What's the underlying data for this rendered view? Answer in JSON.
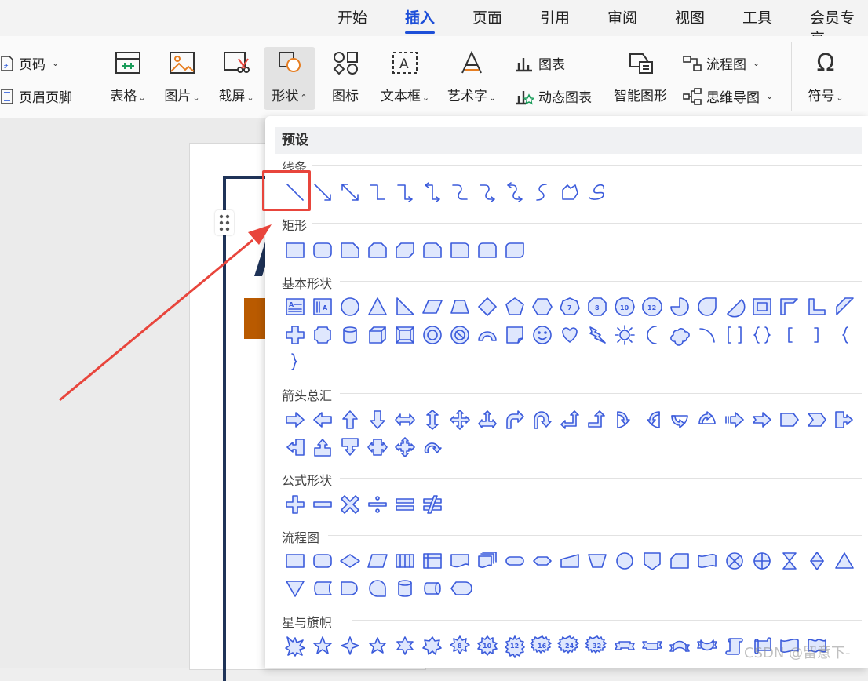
{
  "menu": {
    "tabs": [
      {
        "label": "开始"
      },
      {
        "label": "插入"
      },
      {
        "label": "页面"
      },
      {
        "label": "引用"
      },
      {
        "label": "审阅"
      },
      {
        "label": "视图"
      },
      {
        "label": "工具"
      },
      {
        "label": "会员专享"
      }
    ],
    "active_tab": "插入",
    "accent_color": "#1d4fd8"
  },
  "ribbon": {
    "page_number": "页码",
    "header_footer": "页眉页脚",
    "table": "表格",
    "picture": "图片",
    "screenshot": "截屏",
    "shapes": "形状",
    "icons": "图标",
    "textbox": "文本框",
    "wordart": "艺术字",
    "chart": "图表",
    "dynamic_chart": "动态图表",
    "smart_graphic": "智能图形",
    "flowchart": "流程图",
    "mindmap": "思维导图",
    "symbol": "符号"
  },
  "panel": {
    "header": "预设",
    "sections": {
      "lines": "线条",
      "rectangles": "矩形",
      "basic_shapes": "基本形状",
      "block_arrows": "箭头总汇",
      "equation_shapes": "公式形状",
      "flowchart": "流程图",
      "stars_banners": "星与旗帜"
    },
    "shape_color": "#3b5bdb",
    "badge_numbers": [
      "7",
      "8",
      "10",
      "12"
    ],
    "star_numbers": [
      "8",
      "10",
      "12",
      "16",
      "24",
      "32"
    ]
  },
  "annotation": {
    "highlight_color": "#e8453c"
  },
  "watermark": "CSDN @留意下-"
}
